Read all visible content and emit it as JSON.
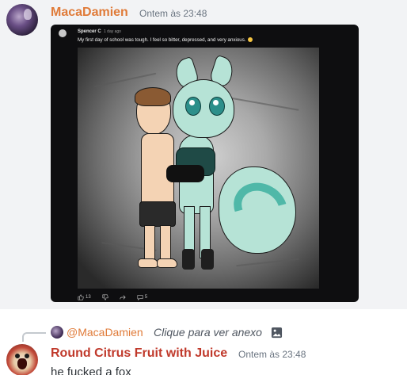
{
  "message1": {
    "username": "MacaDamien",
    "timestamp": "Ontem às 23:48",
    "attachment": {
      "post_author": "Spencer C",
      "post_time": "1 day ago",
      "post_text": "My first day of school was tough. I feel so bitter, depressed, and very anxious.",
      "likes": "13",
      "dislike_icon": "thumbs-down-icon",
      "share_icon": "share-icon",
      "comments": "5"
    }
  },
  "reply_preview": {
    "mention": "@MacaDamien",
    "hint": "Clique para ver anexo",
    "icon": "image-icon"
  },
  "message2": {
    "username": "Round Citrus Fruit with Juice",
    "timestamp": "Ontem às 23:48",
    "text": "he fucked a fox"
  },
  "colors": {
    "username1": "#e07b39",
    "username2": "#c0392b",
    "hover_bg": "#f2f3f5"
  }
}
